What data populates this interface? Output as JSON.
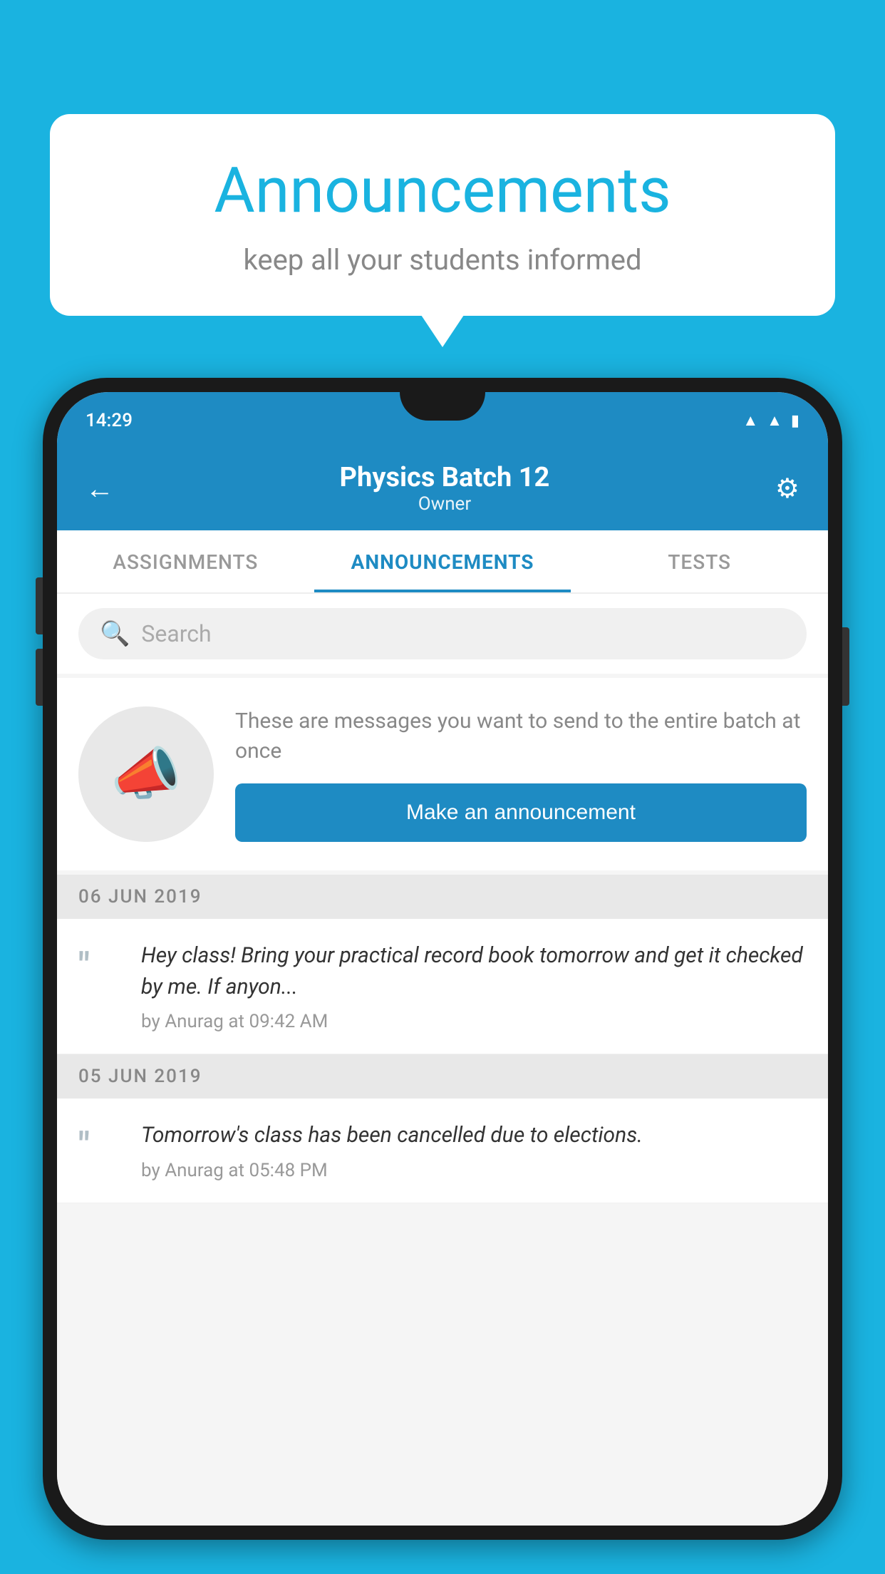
{
  "background_color": "#1ab3e0",
  "speech_bubble": {
    "title": "Announcements",
    "subtitle": "keep all your students informed"
  },
  "phone": {
    "status_bar": {
      "time": "14:29"
    },
    "app_bar": {
      "title": "Physics Batch 12",
      "subtitle": "Owner",
      "back_label": "←",
      "gear_label": "⚙"
    },
    "tabs": [
      {
        "label": "ASSIGNMENTS",
        "active": false
      },
      {
        "label": "ANNOUNCEMENTS",
        "active": true
      },
      {
        "label": "TESTS",
        "active": false
      }
    ],
    "search": {
      "placeholder": "Search"
    },
    "announcement_prompt": {
      "description_text": "These are messages you want to send to the entire batch at once",
      "button_label": "Make an announcement"
    },
    "announcements": [
      {
        "date": "06  JUN  2019",
        "text": "Hey class! Bring your practical record book tomorrow and get it checked by me. If anyon...",
        "meta": "by Anurag at 09:42 AM"
      },
      {
        "date": "05  JUN  2019",
        "text": "Tomorrow's class has been cancelled due to elections.",
        "meta": "by Anurag at 05:48 PM"
      }
    ]
  }
}
